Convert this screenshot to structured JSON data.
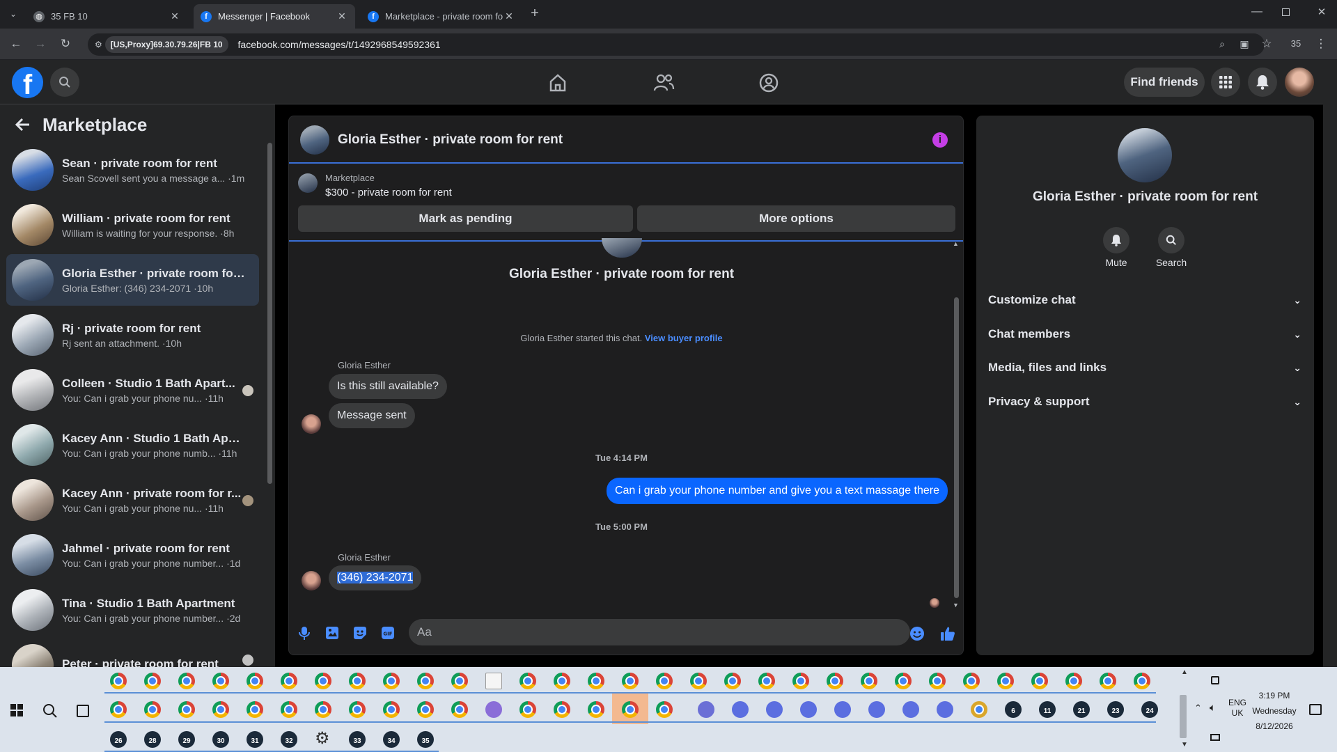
{
  "browser": {
    "tabs": [
      {
        "title": "35 FB 10"
      },
      {
        "title": "Messenger | Facebook"
      },
      {
        "title": "Marketplace - private room for"
      }
    ],
    "proxy_chip": "[US,Proxy]69.30.79.26|FB 10",
    "url": "facebook.com/messages/t/1492968549592361",
    "profile_label": "35"
  },
  "fb_header": {
    "find_friends": "Find friends"
  },
  "sidebar": {
    "title": "Marketplace",
    "conversations": [
      {
        "name": "Sean · private room for rent",
        "preview": "Sean Scovell sent you a message a... ·1m"
      },
      {
        "name": "William · private room for rent",
        "preview": "William is waiting for your response. ·8h"
      },
      {
        "name": "Gloria Esther · private room for r...",
        "preview": "Gloria Esther: (346) 234-2071 ·10h"
      },
      {
        "name": "Rj · private room for rent",
        "preview": "Rj sent an attachment. ·10h"
      },
      {
        "name": "Colleen · Studio 1 Bath Apart...",
        "preview": "You: Can i grab your phone nu... ·11h"
      },
      {
        "name": "Kacey Ann · Studio 1 Bath Apart...",
        "preview": "You: Can i grab your phone numb... ·11h"
      },
      {
        "name": "Kacey Ann · private room for r...",
        "preview": "You: Can i grab your phone nu... ·11h"
      },
      {
        "name": "Jahmel · private room for rent",
        "preview": "You: Can i grab your phone number... ·1d"
      },
      {
        "name": "Tina · Studio 1 Bath Apartment",
        "preview": "You: Can i grab your phone number... ·2d"
      },
      {
        "name": "Peter · private room for rent",
        "preview": ""
      }
    ]
  },
  "chat": {
    "title": "Gloria Esther · private room for rent",
    "listing_source": "Marketplace",
    "listing": "$300 - private room for rent",
    "mark_pending": "Mark as pending",
    "more_options": "More options",
    "intro_name": "Gloria Esther · private room for rent",
    "started_text": "Gloria Esther started this chat.",
    "view_profile": "View buyer profile",
    "sender1": "Gloria Esther",
    "msg1": "Is this still available?",
    "msg2": "Message sent",
    "time1": "Tue 4:14 PM",
    "msg_out": "Can i grab your phone number and give  you a text massage there",
    "time2": "Tue 5:00 PM",
    "sender2": "Gloria Esther",
    "msg3": "(346) 234-2071",
    "input_placeholder": "Aa"
  },
  "right_panel": {
    "name": "Gloria Esther · private room for rent",
    "mute": "Mute",
    "search": "Search",
    "sections": [
      "Customize chat",
      "Chat members",
      "Media, files and links",
      "Privacy & support"
    ]
  },
  "taskbar": {
    "lang1": "ENG",
    "lang2": "UK",
    "time": "3:19 PM",
    "day": "Wednesday",
    "date": "8/12/2026",
    "badges_row2": [
      "6",
      "11",
      "21",
      "23",
      "24"
    ],
    "badges_row3": [
      "26",
      "28",
      "29",
      "30",
      "31",
      "32",
      "33",
      "34",
      "35"
    ]
  },
  "colors": {
    "accent": "#0a66ff",
    "fb_blue": "#1877f2",
    "link": "#4a8dff"
  }
}
